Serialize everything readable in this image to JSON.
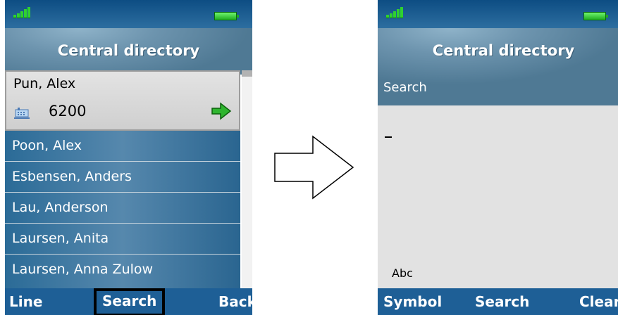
{
  "left_screen": {
    "title": "Central directory",
    "selected_contact": {
      "name": "Pun, Alex",
      "number": "6200"
    },
    "contacts": [
      "Poon, Alex",
      "Esbensen, Anders",
      "Lau, Anderson",
      "Laursen, Anita",
      "Laursen, Anna Zulow"
    ],
    "softkeys": {
      "left": "Line",
      "middle": "Search",
      "right": "Back"
    }
  },
  "right_screen": {
    "title": "Central directory",
    "subtitle": "Search",
    "input_mode": "Abc",
    "softkeys": {
      "left": "Symbol",
      "middle": "Search",
      "right": "Clear"
    }
  },
  "colors": {
    "statusbar": "#1e5f96",
    "accent": "#2fd12f"
  },
  "icons": [
    "signal-icon",
    "battery-icon",
    "phone-extension-icon",
    "call-arrow-icon",
    "flow-arrow-icon"
  ]
}
